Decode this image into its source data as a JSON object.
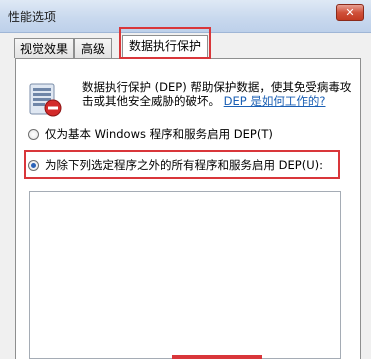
{
  "window": {
    "title": "性能选项",
    "close_glyph": "✕"
  },
  "tabs": [
    {
      "label": "视觉效果",
      "active": false
    },
    {
      "label": "高级",
      "active": false
    },
    {
      "label": "数据执行保护",
      "active": true
    }
  ],
  "dep": {
    "description": "数据执行保护 (DEP) 帮助保护数据，使其免受病毒攻击或其他安全威胁的破坏。",
    "link_text": "DEP 是如何工作的?",
    "option_basic": "仅为基本 Windows 程序和服务启用 DEP(T)",
    "option_all": "为除下列选定程序之外的所有程序和服务启用 DEP(U):",
    "selected_option": "option_all"
  },
  "colors": {
    "highlight_box": "#d9363a",
    "link": "#1a5fb4"
  }
}
